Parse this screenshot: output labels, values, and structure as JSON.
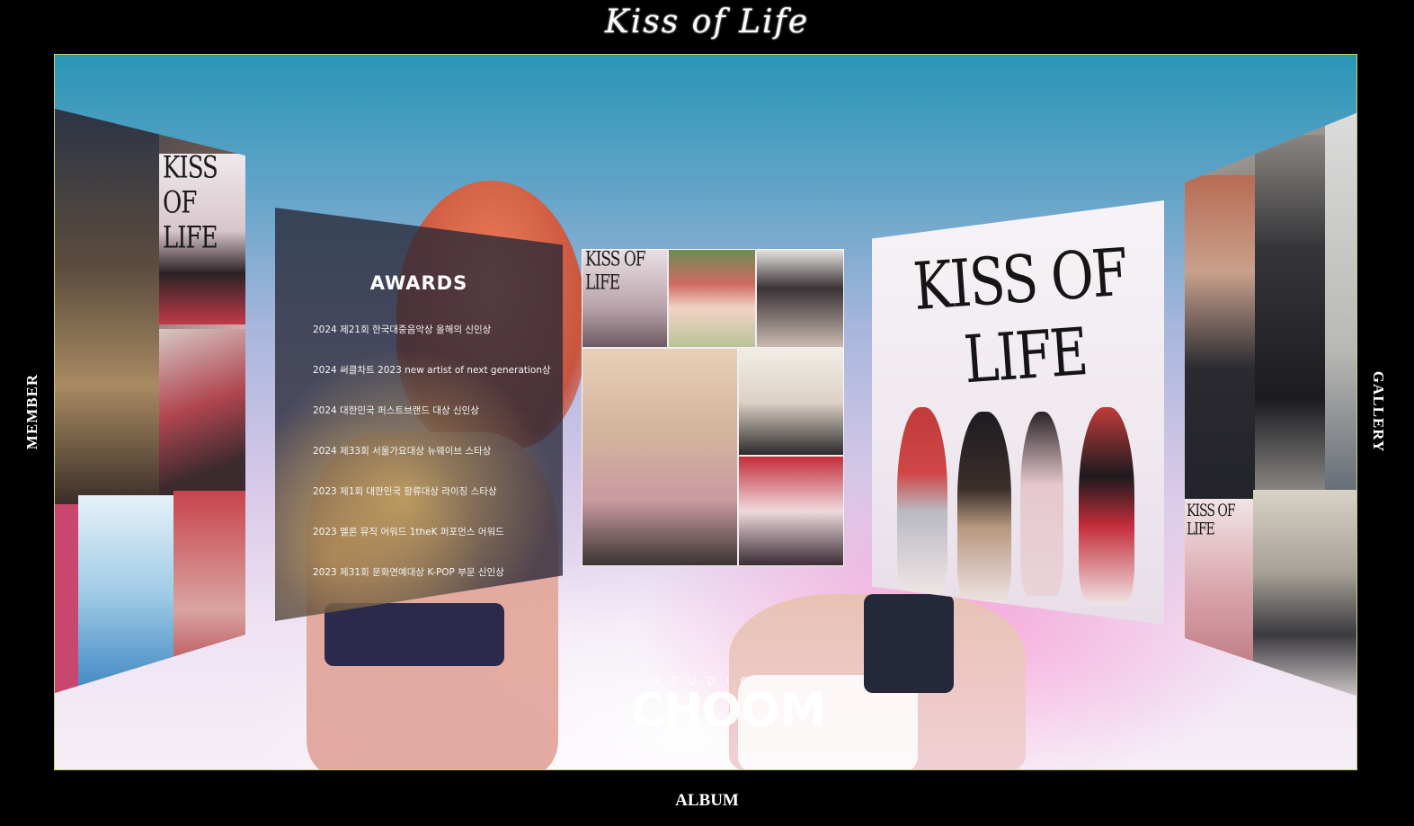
{
  "site": {
    "title": "Kiss of  Life"
  },
  "nav": {
    "left": "MEMBER",
    "right": "GALLERY",
    "bottom": "ALBUM"
  },
  "awards": {
    "title": "AWARDS",
    "items": [
      "2024 제21회 한국대중음악상 올해의 신인상",
      "2024 써클차트 2023 new artist of next generation상",
      "2024 대한민국 퍼스트브랜드 대상 신인상",
      "2024 제33회 서울가요대상 뉴웨이브 스타상",
      "2023 제1회 대한민국 팡류대상 라이징 스타상",
      "2023 멜론 뮤직 어워드 1theK 퍼포먼스 어워드",
      "2023 제31회 문화연예대상 K-POP 부문 신인상"
    ]
  },
  "posters": {
    "main_logo": "KISS OF LIFE",
    "small_logo": "KISS OF LIFE"
  },
  "brand": {
    "sub": "STUDIO",
    "main": "CHOOM"
  }
}
